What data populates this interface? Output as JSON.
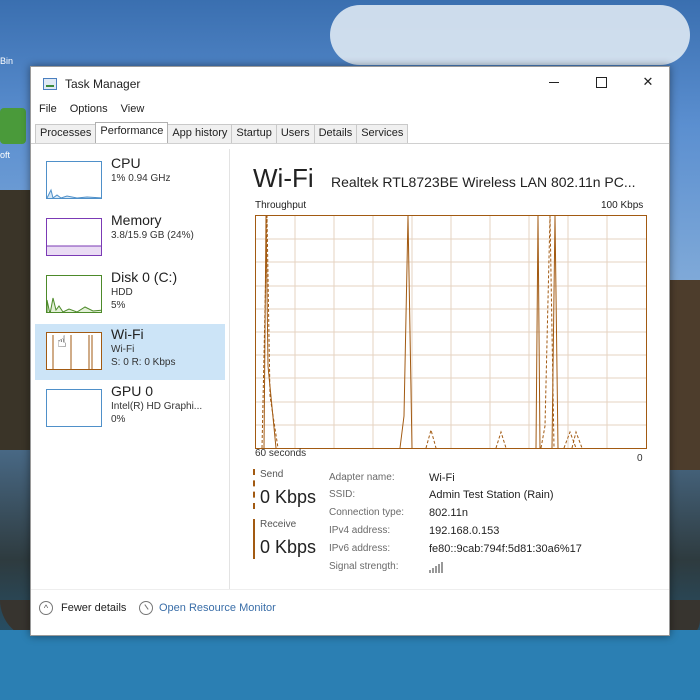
{
  "desktop": {
    "icon_labels": [
      "Bin",
      "oft"
    ]
  },
  "window": {
    "title": "Task Manager",
    "controls": [
      "minimize",
      "maximize",
      "close"
    ]
  },
  "menu": [
    "File",
    "Options",
    "View"
  ],
  "tabs": [
    "Processes",
    "Performance",
    "App history",
    "Startup",
    "Users",
    "Details",
    "Services"
  ],
  "active_tab": "Performance",
  "sidebar": [
    {
      "name": "CPU",
      "line1": "1% 0.94 GHz",
      "line2": ""
    },
    {
      "name": "Memory",
      "line1": "3.8/15.9 GB (24%)",
      "line2": ""
    },
    {
      "name": "Disk 0 (C:)",
      "line1": "HDD",
      "line2": "5%"
    },
    {
      "name": "Wi-Fi",
      "line1": "Wi-Fi",
      "line2": "S: 0 R: 0 Kbps"
    },
    {
      "name": "GPU 0",
      "line1": "Intel(R) HD Graphi...",
      "line2": "0%"
    }
  ],
  "main": {
    "title": "Wi-Fi",
    "subtitle": "Realtek RTL8723BE Wireless LAN 802.11n PC...",
    "graph_label": "Throughput",
    "graph_max": "100 Kbps",
    "graph_left": "60 seconds",
    "graph_right": "0",
    "send_label": "Send",
    "send_value": "0 Kbps",
    "receive_label": "Receive",
    "receive_value": "0 Kbps",
    "properties": [
      {
        "key": "Adapter name:",
        "value": "Wi-Fi"
      },
      {
        "key": "SSID:",
        "value": "Admin Test Station (Rain)"
      },
      {
        "key": "Connection type:",
        "value": "802.11n"
      },
      {
        "key": "IPv4 address:",
        "value": "192.168.0.153"
      },
      {
        "key": "IPv6 address:",
        "value": "fe80::9cab:794f:5d81:30a6%17"
      },
      {
        "key": "Signal strength:",
        "value": ""
      }
    ]
  },
  "footer": {
    "fewer_details": "Fewer details",
    "resource_monitor": "Open Resource Monitor"
  },
  "colors": {
    "selected_bg": "#cce4f7",
    "wifi_accent": "#a25a12",
    "cpu_accent": "#4f90c9",
    "memory_accent": "#7b3ab5",
    "disk_accent": "#4d8a2a"
  }
}
